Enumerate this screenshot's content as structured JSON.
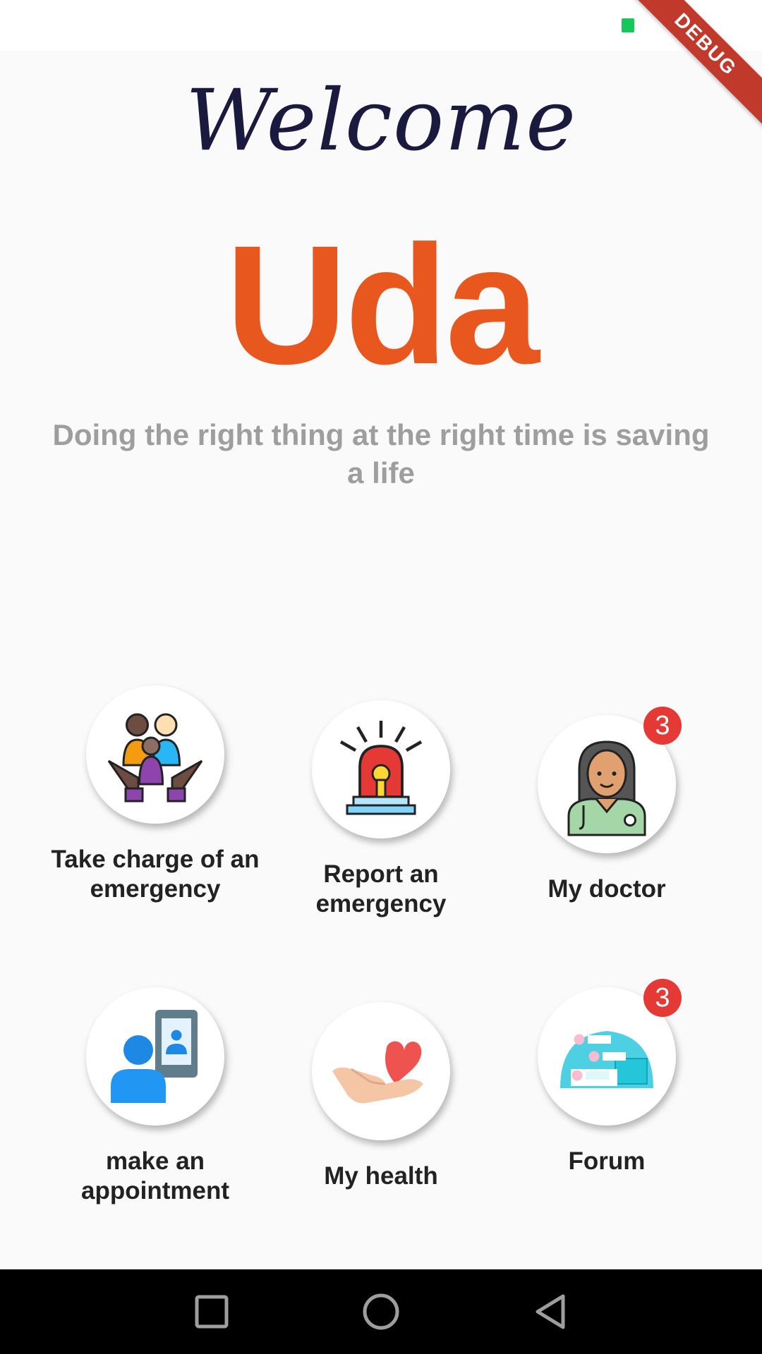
{
  "status_bar": {
    "icon": "notification-icon"
  },
  "debug_ribbon": {
    "label": "DEBUG"
  },
  "header": {
    "welcome": "Welcome",
    "app_name": "Uda",
    "tagline": "Doing the right thing at the right time is saving a life"
  },
  "tiles": [
    {
      "label": "Take charge of an emergency",
      "icon": "family-care-icon",
      "badge": ""
    },
    {
      "label": "Report an emergency",
      "icon": "siren-icon",
      "badge": ""
    },
    {
      "label": "My doctor",
      "icon": "doctor-icon",
      "badge": "3"
    },
    {
      "label": "make an appointment",
      "icon": "appointment-icon",
      "badge": ""
    },
    {
      "label": "My health",
      "icon": "heart-hand-icon",
      "badge": ""
    },
    {
      "label": "Forum",
      "icon": "forum-icon",
      "badge": "3"
    }
  ],
  "nav_bar": {
    "buttons": [
      "recents-button",
      "home-button",
      "back-button"
    ]
  },
  "colors": {
    "accent": "#e8571e",
    "badge": "#e53935",
    "tagline": "#9e9e9e",
    "welcome": "#1a1a3e"
  }
}
